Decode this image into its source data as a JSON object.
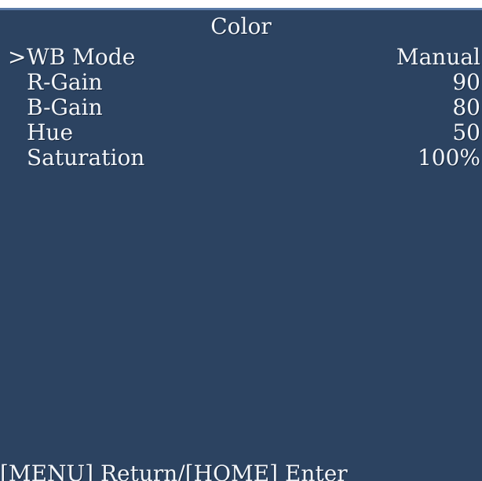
{
  "menu": {
    "title": "Color",
    "cursor_glyph": ">",
    "selected_index": 0,
    "items": [
      {
        "label": "WB Mode",
        "value": "Manual"
      },
      {
        "label": "R-Gain",
        "value": "90"
      },
      {
        "label": "B-Gain",
        "value": "80"
      },
      {
        "label": "Hue",
        "value": "50"
      },
      {
        "label": "Saturation",
        "value": "100%"
      }
    ]
  },
  "footer": {
    "hint": "[MENU] Return/[HOME] Enter"
  },
  "colors": {
    "background": "#2c4361",
    "top_border": "#5a7aa6",
    "text": "#f2f5f9"
  }
}
